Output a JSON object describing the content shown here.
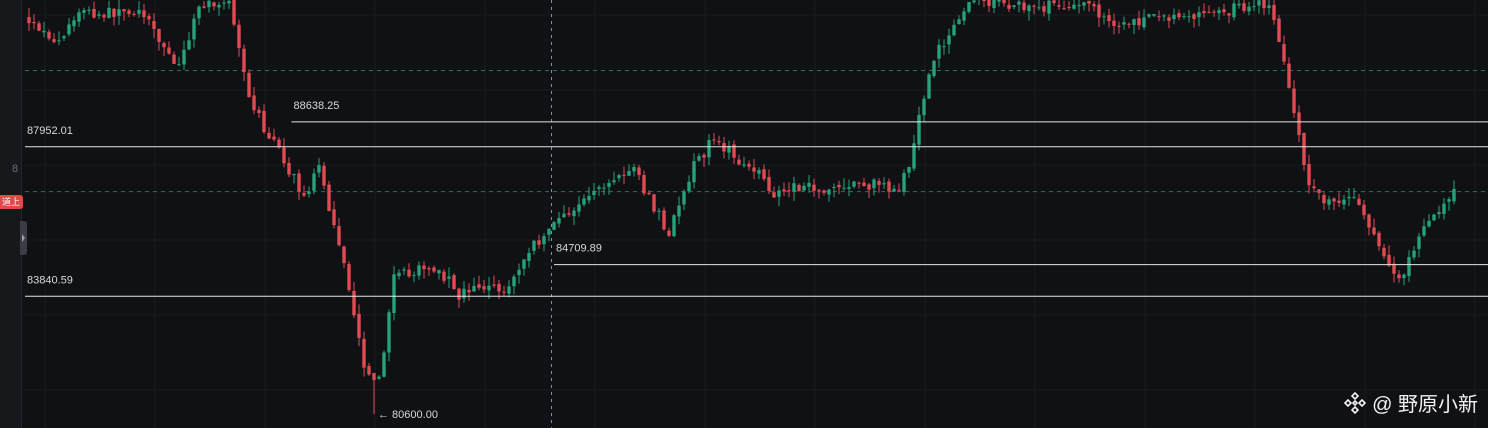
{
  "chart_data": {
    "type": "candlestick",
    "colors": {
      "background": "#101114",
      "up": "#26a17b",
      "down": "#e04b53",
      "level_line": "#e6e6e6",
      "dashed_line": "#1f7a5c",
      "crosshair": "#8a8d93",
      "text": "#d6d8dc"
    },
    "y_range": [
      80300,
      92100
    ],
    "candle_count": 250,
    "levels": [
      {
        "label": "88638.25",
        "value": 88638.25,
        "start_candle": 0.21
      },
      {
        "label": "87952.01",
        "value": 87952.01,
        "start_candle": 0
      },
      {
        "label": "84709.89",
        "value": 84709.89,
        "start_candle": 0.42
      },
      {
        "label": "83840.59",
        "value": 83840.59,
        "start_candle": 0
      }
    ],
    "dashed_levels": [
      90050,
      86720
    ],
    "low_marker": {
      "label": "← 80600.00",
      "value": 80600.0
    },
    "crosshair_candle": 0.418,
    "anchors": [
      [
        0,
        91500
      ],
      [
        6,
        90800
      ],
      [
        10,
        91700
      ],
      [
        14,
        91600
      ],
      [
        22,
        91700
      ],
      [
        30,
        90100
      ],
      [
        34,
        91900
      ],
      [
        40,
        91900
      ],
      [
        44,
        89200
      ],
      [
        50,
        87800
      ],
      [
        55,
        86600
      ],
      [
        58,
        87300
      ],
      [
        63,
        84800
      ],
      [
        67,
        82000
      ],
      [
        70,
        81500
      ],
      [
        73,
        84300
      ],
      [
        76,
        84500
      ],
      [
        82,
        84600
      ],
      [
        86,
        83900
      ],
      [
        91,
        84100
      ],
      [
        96,
        84100
      ],
      [
        100,
        85100
      ],
      [
        106,
        86000
      ],
      [
        111,
        86500
      ],
      [
        117,
        87100
      ],
      [
        121,
        87300
      ],
      [
        125,
        86300
      ],
      [
        128,
        85600
      ],
      [
        133,
        87400
      ],
      [
        137,
        88200
      ],
      [
        141,
        87700
      ],
      [
        145,
        87400
      ],
      [
        149,
        86700
      ],
      [
        153,
        86900
      ],
      [
        160,
        86800
      ],
      [
        165,
        86900
      ],
      [
        170,
        86900
      ],
      [
        173,
        86700
      ],
      [
        176,
        87300
      ],
      [
        180,
        90100
      ],
      [
        186,
        91600
      ],
      [
        190,
        92000
      ],
      [
        196,
        91900
      ],
      [
        202,
        91800
      ],
      [
        210,
        91900
      ],
      [
        218,
        91300
      ],
      [
        226,
        91500
      ],
      [
        234,
        91600
      ],
      [
        240,
        91700
      ],
      [
        244,
        91900
      ],
      [
        248,
        91900
      ],
      [
        252,
        89700
      ],
      [
        256,
        86900
      ],
      [
        260,
        86400
      ],
      [
        265,
        86600
      ],
      [
        270,
        85100
      ],
      [
        274,
        84300
      ],
      [
        278,
        85400
      ],
      [
        282,
        86300
      ],
      [
        285,
        86700
      ]
    ]
  },
  "watermark": {
    "text": "@ 野原小新"
  },
  "side_badge": "道上",
  "edge_glyph": "8"
}
